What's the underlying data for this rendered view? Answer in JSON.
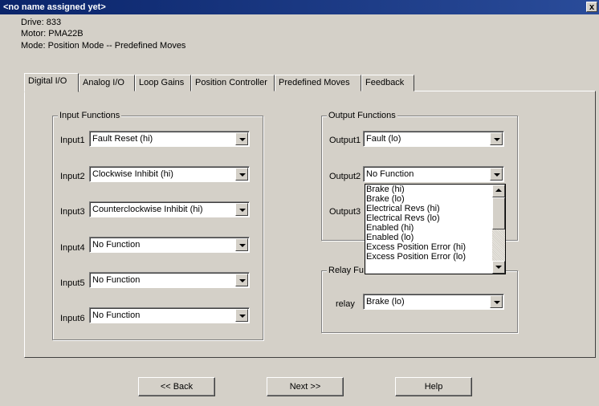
{
  "window": {
    "title": "<no name assigned yet>",
    "close_glyph": "x"
  },
  "info": {
    "drive": "Drive: 833",
    "motor": "Motor: PMA22B",
    "mode": "Mode: Position Mode -- Predefined Moves"
  },
  "tabs": [
    {
      "label": "Digital I/O"
    },
    {
      "label": "Analog I/O"
    },
    {
      "label": "Loop Gains"
    },
    {
      "label": "Position Controller"
    },
    {
      "label": "Predefined Moves"
    },
    {
      "label": "Feedback"
    }
  ],
  "input_functions": {
    "title": "Input Functions",
    "rows": [
      {
        "label": "Input1",
        "value": "Fault Reset (hi)"
      },
      {
        "label": "Input2",
        "value": "Clockwise Inhibit (hi)"
      },
      {
        "label": "Input3",
        "value": "Counterclockwise Inhibit (hi)"
      },
      {
        "label": "Input4",
        "value": "No Function"
      },
      {
        "label": "Input5",
        "value": "No Function"
      },
      {
        "label": "Input6",
        "value": "No Function"
      }
    ]
  },
  "output_functions": {
    "title": "Output Functions",
    "rows": [
      {
        "label": "Output1",
        "value": "Fault (lo)"
      },
      {
        "label": "Output2",
        "value": "No Function"
      },
      {
        "label": "Output3",
        "value": ""
      }
    ]
  },
  "relay_functions": {
    "title": "Relay Fu",
    "label": "relay",
    "value": "Brake (lo)"
  },
  "dropdown_options": [
    "Brake (hi)",
    "Brake (lo)",
    "Electrical Revs (hi)",
    "Electrical Revs (lo)",
    "Enabled (hi)",
    "Enabled (lo)",
    "Excess Position Error (hi)",
    "Excess Position Error (lo)"
  ],
  "buttons": {
    "back": "<< Back",
    "next": "Next >>",
    "help": "Help"
  },
  "colors": {
    "titlebar": "#0a246a",
    "face": "#d4d0c8"
  }
}
